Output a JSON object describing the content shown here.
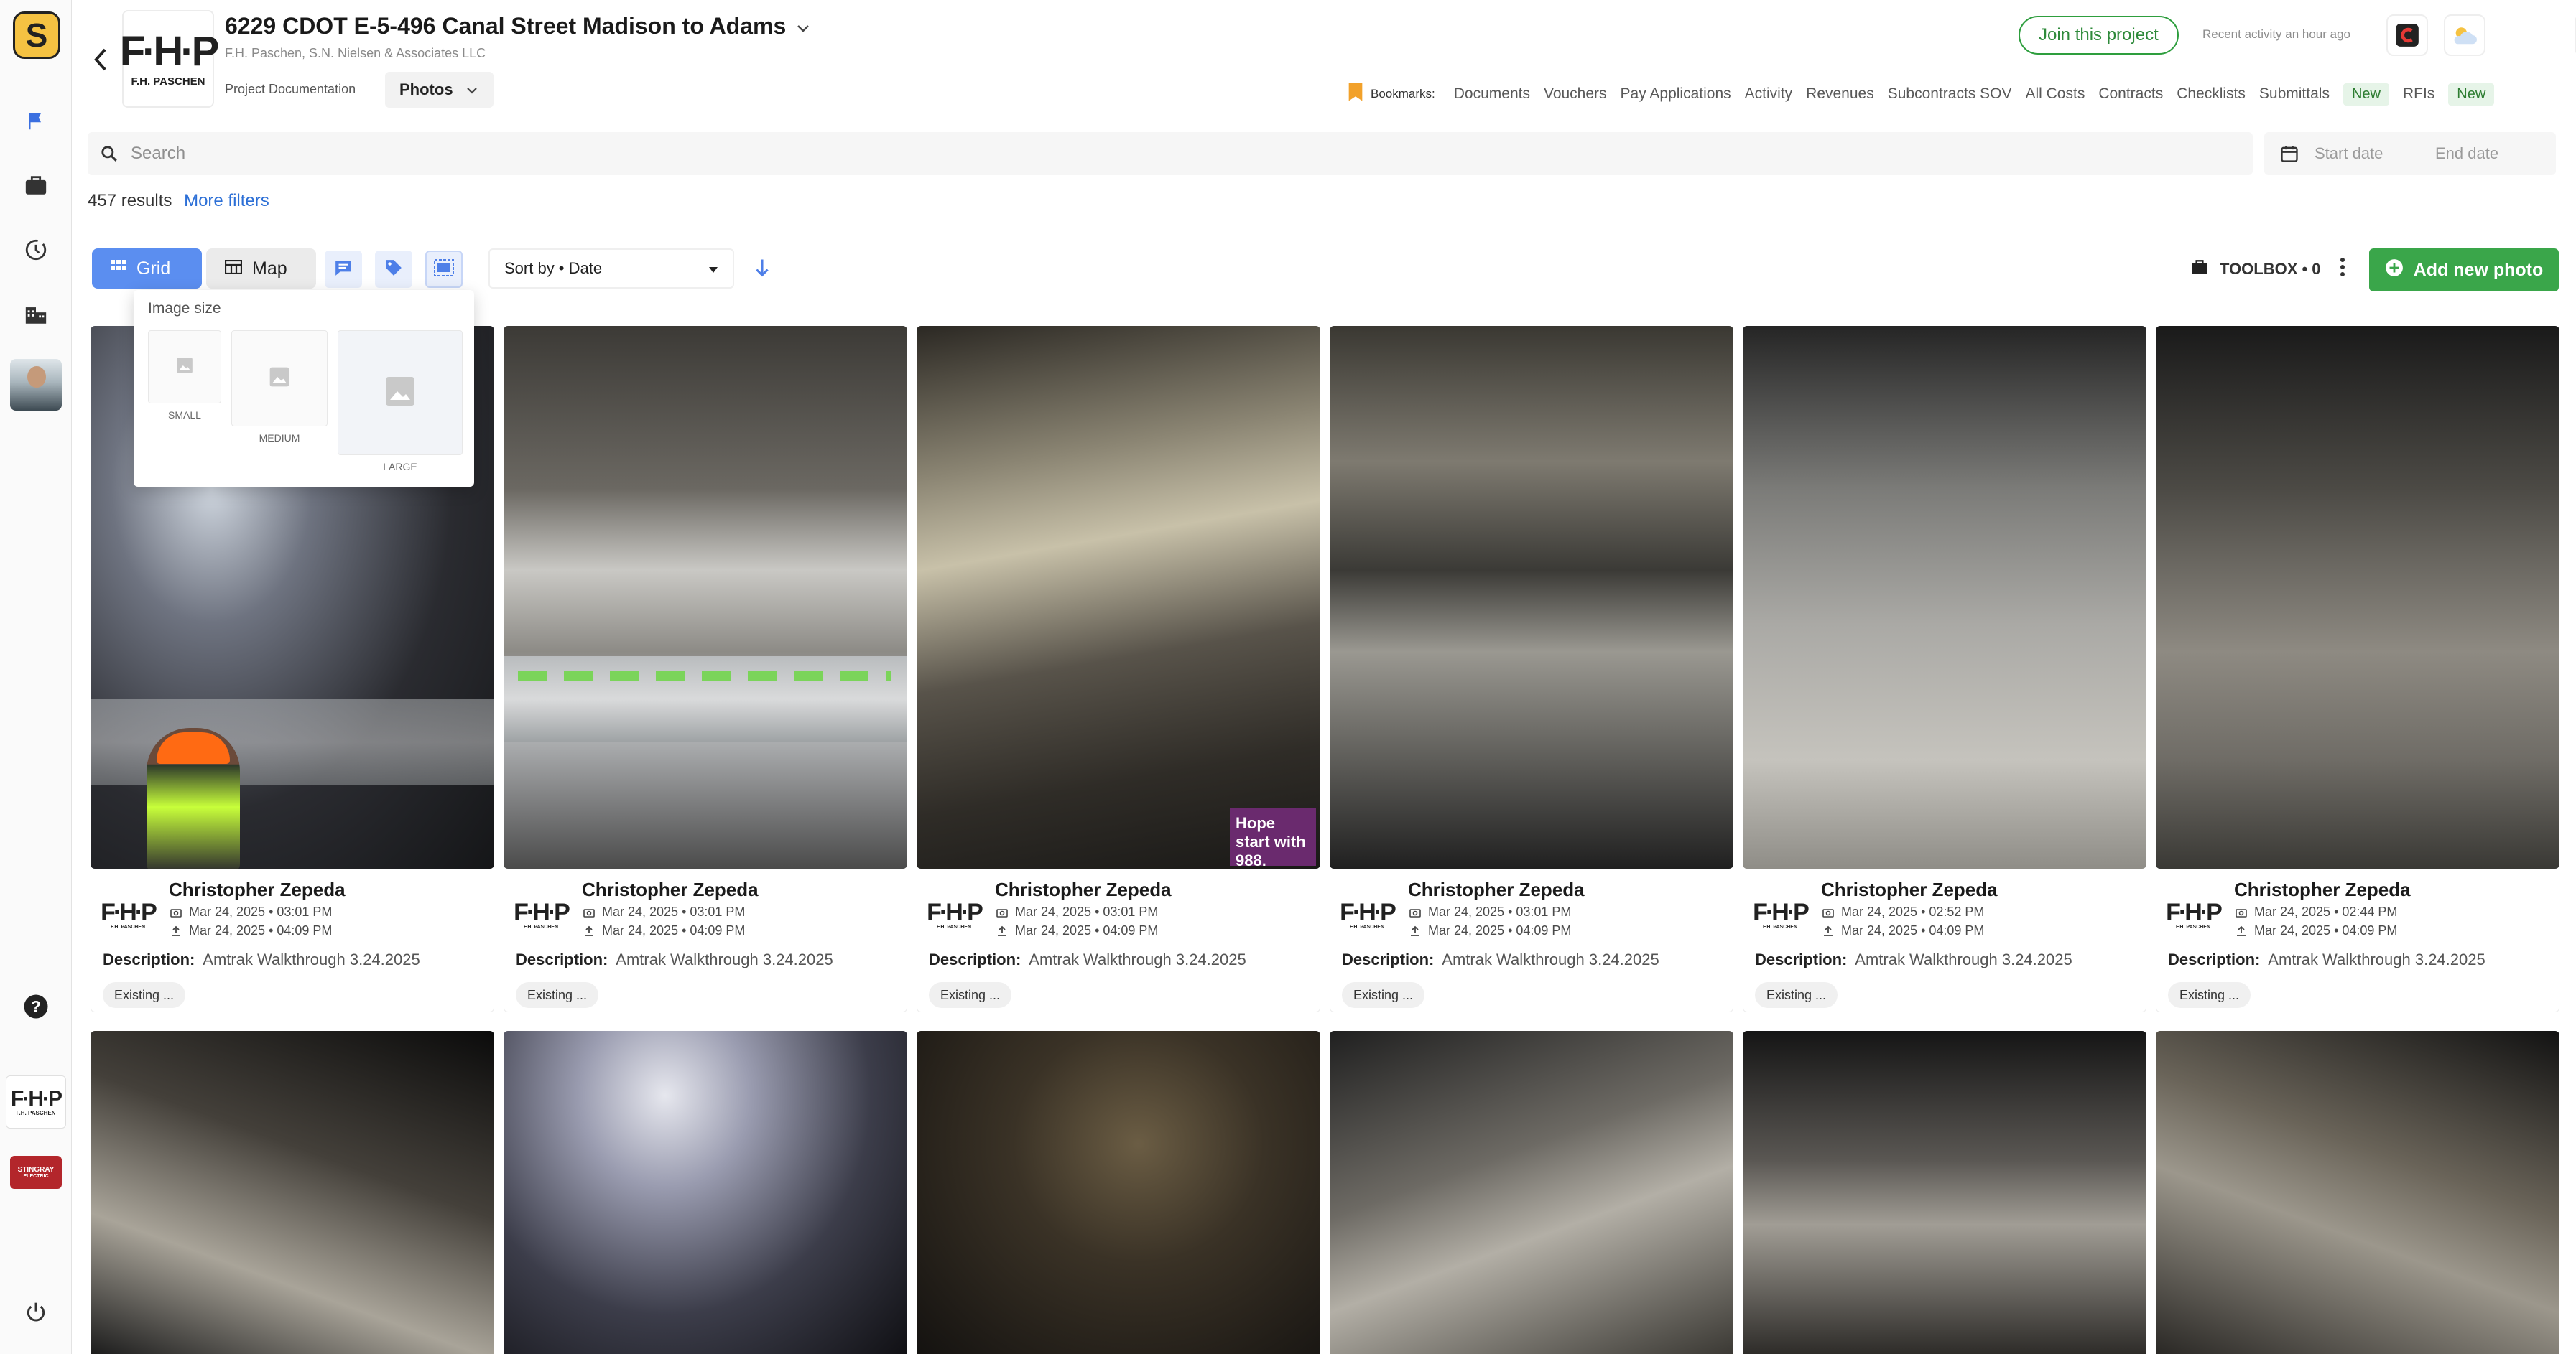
{
  "rail": {
    "logo_letter": "S",
    "company_brand": "F·H·P",
    "company_brand_sub": "F.H. PASCHEN",
    "stingray_label": "STINGRAY",
    "stingray_sub": "ELECTRIC"
  },
  "header": {
    "project_title": "6229 CDOT E-5-496 Canal Street Madison to Adams",
    "project_subtitle": "F.H. Paschen, S.N. Nielsen & Associates LLC",
    "section_label": "Project Documentation",
    "section_select": "Photos",
    "logo_text": "F·H·P",
    "logo_sub": "F.H. PASCHEN",
    "join_label": "Join this project",
    "recent_activity": "Recent activity an hour ago",
    "bookmarks_label": "Bookmarks:",
    "bookmarks": [
      {
        "label": "Documents"
      },
      {
        "label": "Vouchers"
      },
      {
        "label": "Pay Applications"
      },
      {
        "label": "Activity"
      },
      {
        "label": "Revenues"
      },
      {
        "label": "Subcontracts SOV"
      },
      {
        "label": "All Costs"
      },
      {
        "label": "Contracts"
      },
      {
        "label": "Checklists"
      },
      {
        "label": "Submittals",
        "badge": "New"
      },
      {
        "label": "RFIs",
        "badge": "New"
      }
    ]
  },
  "search": {
    "placeholder": "Search",
    "start_date_placeholder": "Start date",
    "end_date_placeholder": "End date"
  },
  "results": {
    "count_text": "457 results",
    "more_filters": "More filters"
  },
  "toolbar": {
    "grid_label": "Grid",
    "map_label": "Map",
    "sort_label": "Sort by • Date",
    "toolbox_label": "TOOLBOX • 0",
    "add_photo_label": "Add new photo"
  },
  "image_size": {
    "title": "Image size",
    "small": "SMALL",
    "medium": "MEDIUM",
    "large": "LARGE"
  },
  "photos": [
    {
      "author": "Christopher Zepeda",
      "taken": "Mar 24, 2025 • 03:01 PM",
      "uploaded": "Mar 24, 2025 • 04:09 PM",
      "description_label": "Description:",
      "description": "Amtrak Walkthrough 3.24.2025",
      "tag": "Existing ..."
    },
    {
      "author": "Christopher Zepeda",
      "taken": "Mar 24, 2025 • 03:01 PM",
      "uploaded": "Mar 24, 2025 • 04:09 PM",
      "description_label": "Description:",
      "description": "Amtrak Walkthrough 3.24.2025",
      "tag": "Existing ..."
    },
    {
      "author": "Christopher Zepeda",
      "taken": "Mar 24, 2025 • 03:01 PM",
      "uploaded": "Mar 24, 2025 • 04:09 PM",
      "description_label": "Description:",
      "description": "Amtrak Walkthrough 3.24.2025",
      "tag": "Existing ...",
      "sign_text": "Hope start with 988."
    },
    {
      "author": "Christopher Zepeda",
      "taken": "Mar 24, 2025 • 03:01 PM",
      "uploaded": "Mar 24, 2025 • 04:09 PM",
      "description_label": "Description:",
      "description": "Amtrak Walkthrough 3.24.2025",
      "tag": "Existing ..."
    },
    {
      "author": "Christopher Zepeda",
      "taken": "Mar 24, 2025 • 02:52 PM",
      "uploaded": "Mar 24, 2025 • 04:09 PM",
      "description_label": "Description:",
      "description": "Amtrak Walkthrough 3.24.2025",
      "tag": "Existing ..."
    },
    {
      "author": "Christopher Zepeda",
      "taken": "Mar 24, 2025 • 02:44 PM",
      "uploaded": "Mar 24, 2025 • 04:09 PM",
      "description_label": "Description:",
      "description": "Amtrak Walkthrough 3.24.2025",
      "tag": "Existing ..."
    }
  ],
  "colors": {
    "accent_blue": "#5b8ef0",
    "add_green": "#3aa64a",
    "join_green": "#2e9e3e",
    "link_blue": "#2c6fd6"
  }
}
